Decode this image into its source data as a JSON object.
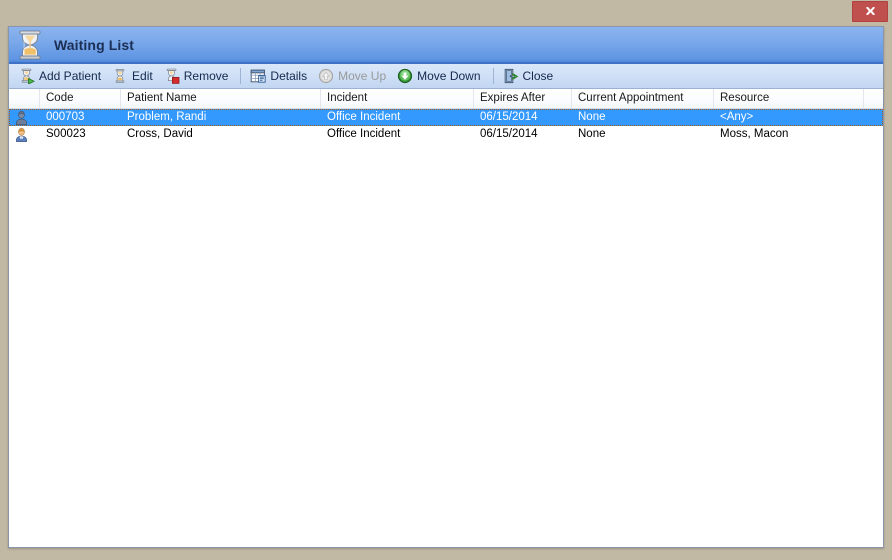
{
  "window": {
    "title": "Waiting List",
    "title_icon": "hourglass-icon",
    "close_icon": "close-x-icon"
  },
  "toolbar": {
    "items": [
      {
        "type": "button",
        "label": "Add Patient",
        "icon": "hourglass-add-icon",
        "enabled": true
      },
      {
        "type": "button",
        "label": "Edit",
        "icon": "hourglass-edit-icon",
        "enabled": true
      },
      {
        "type": "button",
        "label": "Remove",
        "icon": "hourglass-remove-icon",
        "enabled": true
      },
      {
        "type": "separator"
      },
      {
        "type": "button",
        "label": "Details",
        "icon": "details-grid-icon",
        "enabled": true
      },
      {
        "type": "button",
        "label": "Move Up",
        "icon": "arrow-up-circle-icon",
        "enabled": false
      },
      {
        "type": "button",
        "label": "Move Down",
        "icon": "arrow-down-circle-icon",
        "enabled": true
      },
      {
        "type": "separator"
      },
      {
        "type": "button",
        "label": "Close",
        "icon": "exit-door-icon",
        "enabled": true
      }
    ]
  },
  "grid": {
    "columns": [
      {
        "key": "icon",
        "label": ""
      },
      {
        "key": "code",
        "label": "Code"
      },
      {
        "key": "name",
        "label": "Patient Name"
      },
      {
        "key": "incident",
        "label": "Incident"
      },
      {
        "key": "expires",
        "label": "Expires After"
      },
      {
        "key": "appointment",
        "label": "Current Appointment"
      },
      {
        "key": "resource",
        "label": "Resource"
      },
      {
        "key": "pad",
        "label": ""
      }
    ],
    "rows": [
      {
        "icon": "patient-avatar-icon",
        "code": "000703",
        "name": "Problem, Randi",
        "incident": "Office Incident",
        "expires": "06/15/2014",
        "appointment": "None",
        "resource": "<Any>",
        "selected": true
      },
      {
        "icon": "patient-avatar-icon",
        "code": "S00023",
        "name": "Cross, David",
        "incident": "Office Incident",
        "expires": "06/15/2014",
        "appointment": "None",
        "resource": "Moss, Macon",
        "selected": false
      }
    ]
  },
  "colors": {
    "desktop": "#c2b9a5",
    "titlebar_top": "#8cb4ee",
    "titlebar_bottom": "#4f88dd",
    "toolbar_bg": "#cfe0f6",
    "selection": "#3399ff",
    "close_button": "#c0504d",
    "accent_green": "#3ba23b",
    "accent_red": "#cc2222"
  }
}
